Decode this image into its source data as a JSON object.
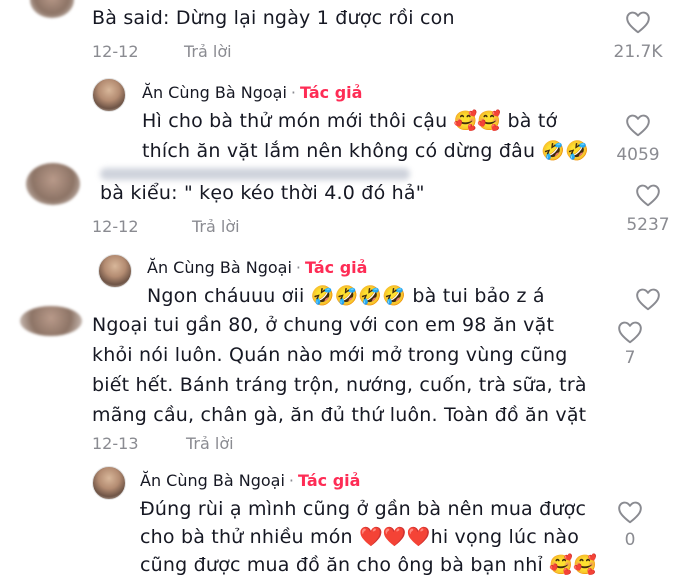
{
  "comments": [
    {
      "text": "Bà said: Dừng lại ngày 1 được rồi con",
      "date": "12-12",
      "reply_label": "Trả lời",
      "likes": "21.7K"
    },
    {
      "author": "Ăn Cùng Bà Ngoại",
      "separator": "·",
      "author_badge": "Tác giả",
      "lines": [
        "Hì cho bà thử món mới thôi cậu 🥰🥰 bà tớ",
        "thích ăn vặt lắm nên không có dừng đâu 🤣🤣"
      ],
      "likes": "4059"
    },
    {
      "text": "bà kiểu: \" kẹo kéo thời 4.0 đó hả\"",
      "date": "12-12",
      "reply_label": "Trả lời",
      "likes": "5237"
    },
    {
      "author": "Ăn Cùng Bà Ngoại",
      "separator": "·",
      "author_badge": "Tác giả",
      "lines": [
        "Ngon cháuuu ơii 🤣🤣🤣🤣 bà tui bảo z á"
      ],
      "likes": ""
    },
    {
      "lines": [
        "Ngoại tui gần 80, ở chung với con em 98 ăn vặt",
        "khỏi nói luôn. Quán nào mới mở trong vùng cũng",
        "biết hết. Bánh tráng trộn, nướng, cuốn, trà sữa, trà",
        "mãng cầu, chân gà, ăn đủ thứ luôn. Toàn đồ ăn vặt"
      ],
      "date": "12-13",
      "reply_label": "Trả lời",
      "likes": "7"
    },
    {
      "author": "Ăn Cùng Bà Ngoại",
      "separator": "·",
      "author_badge": "Tác giả",
      "lines": [
        "Đúng rùi ạ mình cũng ở gần bà nên mua được",
        "cho bà thử nhiều món ❤️❤️❤️hi vọng lúc nào",
        "cũng được mua đồ ăn cho ông bà bạn nhỉ 🥰🥰"
      ],
      "likes": "0"
    }
  ],
  "colors": {
    "author_badge": "#fe2c55",
    "muted": "#8a8b91",
    "text": "#161823"
  },
  "icons": [
    "heart-outline-icon"
  ]
}
